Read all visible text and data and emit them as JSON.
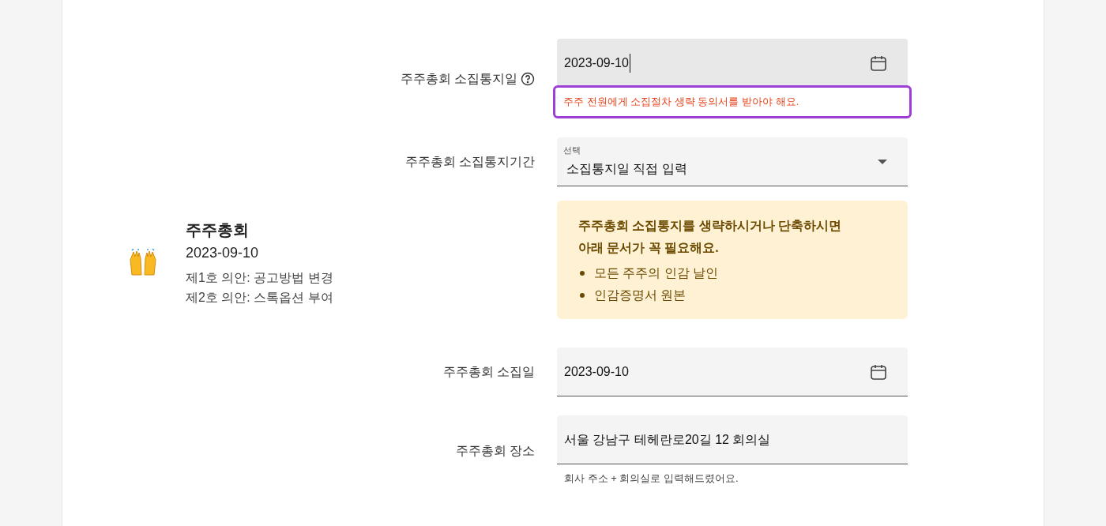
{
  "summary": {
    "title": "주주총회",
    "date": "2023-09-10",
    "items": [
      "제1호 의안: 공고방법 변경",
      "제2호 의안: 스톡옵션 부여"
    ]
  },
  "form": [
    {
      "kind": "date",
      "label": "주주총회 소집통지일",
      "help_icon": true,
      "value": "2023-09-10",
      "focused": true,
      "error": "주주 전원에게 소집절차 생략 동의서를 받아야 해요."
    },
    {
      "kind": "select",
      "label": "주주총회 소집통지기간",
      "caption": "선택",
      "value": "소집통지일 직접 입력"
    },
    {
      "kind": "notice",
      "heading": "주주총회 소집통지를 생략하시거나 단축하시면 아래 문서가 꼭 필요해요.",
      "bullets": [
        "모든 주주의 인감 날인",
        "인감증명서 원본"
      ]
    },
    {
      "kind": "date",
      "label": "주주총회 소집일",
      "help_icon": false,
      "value": "2023-09-10",
      "focused": false
    },
    {
      "kind": "text",
      "label": "주주총회 장소",
      "value": "서울 강남구 테헤란로20길 12 회의실",
      "helper": "회사 주소 + 회의실로 입력해드렸어요."
    }
  ]
}
